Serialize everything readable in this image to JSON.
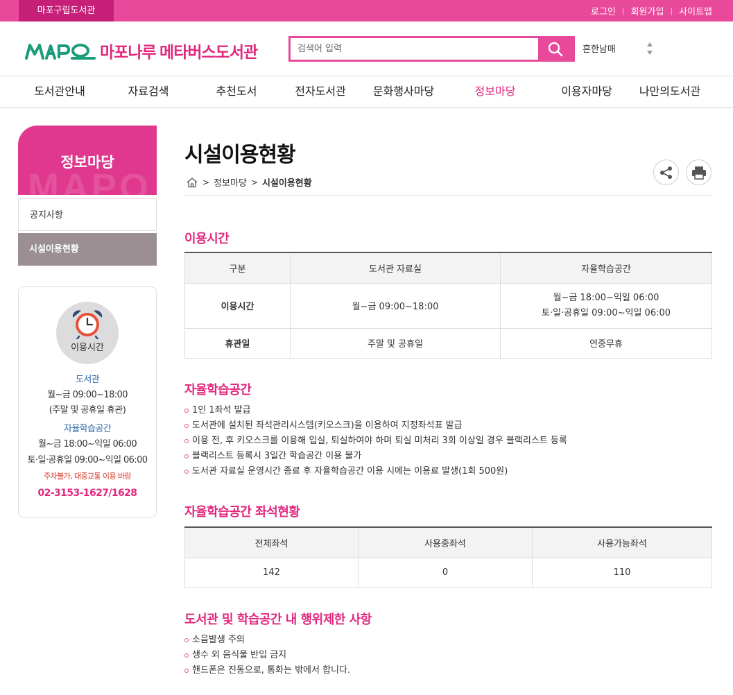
{
  "topbar": {
    "library": "마포구립도서관",
    "login": "로그인",
    "signup": "회원가입",
    "sitemap": "사이트맵"
  },
  "header": {
    "logo_text": "마포나루 메타버스도서관",
    "search_placeholder": "검색어 입력",
    "branch": "흔한남매"
  },
  "gnb": [
    "도서관안내",
    "자료검색",
    "추천도서",
    "전자도서관",
    "문화행사마당",
    "정보마당",
    "이용자마당",
    "나만의도서관"
  ],
  "sidebar": {
    "title": "정보마당",
    "watermark": "MAPO",
    "menu": [
      "공지사항",
      "시설이용현황"
    ],
    "info": {
      "icon_label": "이용시간",
      "library_title": "도서관",
      "library_hours": "월~금 09:00~18:00",
      "library_note": "(주말 및 공휴일 휴관)",
      "study_title": "자율학습공간",
      "study_hours_weekday": "월~금 18:00~익일 06:00",
      "study_hours_weekend": "토·일·공휴일 09:00~익일 06:00",
      "parking_note": "주차불가, 대중교통 이용 바람",
      "phone": "02-3153-1627/1628"
    }
  },
  "main": {
    "title": "시설이용현황",
    "breadcrumb": [
      "정보마당",
      "시설이용현황"
    ],
    "hours_section": {
      "title": "이용시간",
      "headers": [
        "구분",
        "도서관 자료실",
        "자율학습공간"
      ],
      "rows": [
        {
          "label": "이용시간",
          "library": "월~금 09:00~18:00",
          "study_line1": "월~금 18:00~익일 06:00",
          "study_line2": "토·일·공휴일 09:00~익일 06:00"
        },
        {
          "label": "휴관일",
          "library": "주말 및 공휴일",
          "study_line1": "연중무휴"
        }
      ]
    },
    "study_section": {
      "title": "자율학습공간",
      "items": [
        "1인 1좌석 발급",
        "도서관에 설치된 좌석관리시스템(키오스크)을 이용하여 지정좌석표 발급",
        "이용 전, 후 키오스크를 이용해 입실, 퇴실하여야 하며 퇴실 미처리 3회 이상일 경우 블랙리스트 등록",
        "블랙리스트 등록시 3일간 학습공간 이용 불가",
        "도서관 자료실 운영시간 종료 후 자율학습공간 이용 시에는 이용료 발생(1회 500원)"
      ]
    },
    "seats_section": {
      "title": "자율학습공간 좌석현황",
      "headers": [
        "전체좌석",
        "사용중좌석",
        "사용가능좌석"
      ],
      "values": [
        "142",
        "0",
        "110"
      ]
    },
    "rules_section": {
      "title": "도서관 및 학습공간 내 행위제한 사항",
      "items": [
        "소음발생 주의",
        "생수 외 음식물 반입 금지",
        "핸드폰은 진동으로, 통화는 밖에서 합니다."
      ]
    }
  },
  "colors": {
    "brand_pink": "#e8499a",
    "brand_dark_pink": "#c51f78",
    "title_pink": "#e2277e",
    "logo_green": "#1a9b7a",
    "active_menu_gray": "#9b8f93"
  }
}
